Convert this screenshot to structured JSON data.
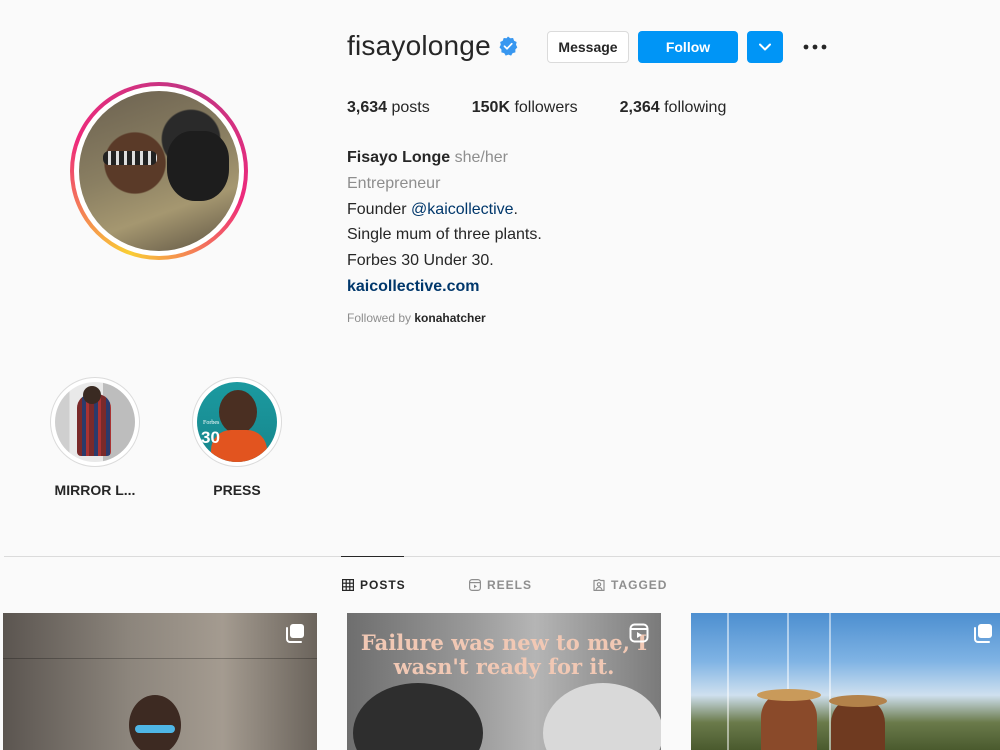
{
  "profile": {
    "username": "fisayolonge",
    "verified": true,
    "actions": {
      "message": "Message",
      "follow": "Follow"
    },
    "stats": {
      "posts_count": "3,634",
      "posts_label": "posts",
      "followers_count": "150K",
      "followers_label": "followers",
      "following_count": "2,364",
      "following_label": "following"
    },
    "bio": {
      "name": "Fisayo Longe",
      "pronouns": "she/her",
      "category": "Entrepreneur",
      "line1_prefix": "Founder",
      "line1_mention": "@kaicollective",
      "line1_suffix": ".",
      "line2": "Single mum of three plants.",
      "line3": "Forbes 30 Under 30.",
      "website": "kaicollective.com"
    },
    "followed_by_prefix": "Followed by",
    "followed_by_user": "konahatcher"
  },
  "highlights": [
    {
      "label": "MIRROR L..."
    },
    {
      "label": "PRESS",
      "badge_top": "Forbes",
      "badge_number": "30"
    }
  ],
  "tabs": [
    {
      "label": "POSTS",
      "active": true
    },
    {
      "label": "REELS",
      "active": false
    },
    {
      "label": "TAGGED",
      "active": false
    }
  ],
  "posts": [
    {
      "type": "carousel"
    },
    {
      "type": "reel",
      "overlay_text": "Failure was new to me, I wasn't ready for it."
    },
    {
      "type": "carousel"
    }
  ],
  "colors": {
    "accent": "#0095f6",
    "link": "#00376b",
    "muted": "#8e8e8e",
    "border": "#dbdbdb"
  }
}
